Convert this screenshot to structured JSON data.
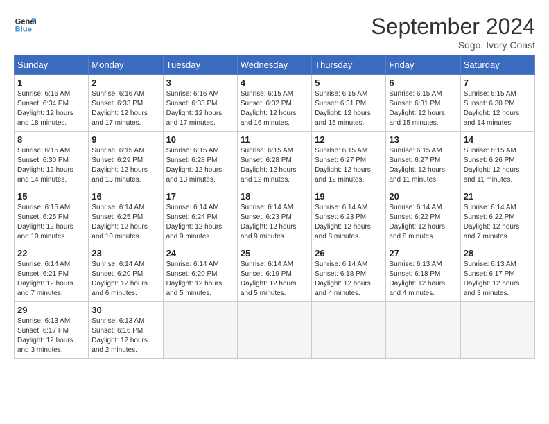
{
  "header": {
    "logo_line1": "General",
    "logo_line2": "Blue",
    "month_title": "September 2024",
    "subtitle": "Sogo, Ivory Coast"
  },
  "weekdays": [
    "Sunday",
    "Monday",
    "Tuesday",
    "Wednesday",
    "Thursday",
    "Friday",
    "Saturday"
  ],
  "weeks": [
    [
      {
        "day": "1",
        "sunrise": "6:16 AM",
        "sunset": "6:34 PM",
        "daylight": "12 hours and 18 minutes."
      },
      {
        "day": "2",
        "sunrise": "6:16 AM",
        "sunset": "6:33 PM",
        "daylight": "12 hours and 17 minutes."
      },
      {
        "day": "3",
        "sunrise": "6:16 AM",
        "sunset": "6:33 PM",
        "daylight": "12 hours and 17 minutes."
      },
      {
        "day": "4",
        "sunrise": "6:15 AM",
        "sunset": "6:32 PM",
        "daylight": "12 hours and 16 minutes."
      },
      {
        "day": "5",
        "sunrise": "6:15 AM",
        "sunset": "6:31 PM",
        "daylight": "12 hours and 15 minutes."
      },
      {
        "day": "6",
        "sunrise": "6:15 AM",
        "sunset": "6:31 PM",
        "daylight": "12 hours and 15 minutes."
      },
      {
        "day": "7",
        "sunrise": "6:15 AM",
        "sunset": "6:30 PM",
        "daylight": "12 hours and 14 minutes."
      }
    ],
    [
      {
        "day": "8",
        "sunrise": "6:15 AM",
        "sunset": "6:30 PM",
        "daylight": "12 hours and 14 minutes."
      },
      {
        "day": "9",
        "sunrise": "6:15 AM",
        "sunset": "6:29 PM",
        "daylight": "12 hours and 13 minutes."
      },
      {
        "day": "10",
        "sunrise": "6:15 AM",
        "sunset": "6:28 PM",
        "daylight": "12 hours and 13 minutes."
      },
      {
        "day": "11",
        "sunrise": "6:15 AM",
        "sunset": "6:28 PM",
        "daylight": "12 hours and 12 minutes."
      },
      {
        "day": "12",
        "sunrise": "6:15 AM",
        "sunset": "6:27 PM",
        "daylight": "12 hours and 12 minutes."
      },
      {
        "day": "13",
        "sunrise": "6:15 AM",
        "sunset": "6:27 PM",
        "daylight": "12 hours and 11 minutes."
      },
      {
        "day": "14",
        "sunrise": "6:15 AM",
        "sunset": "6:26 PM",
        "daylight": "12 hours and 11 minutes."
      }
    ],
    [
      {
        "day": "15",
        "sunrise": "6:15 AM",
        "sunset": "6:25 PM",
        "daylight": "12 hours and 10 minutes."
      },
      {
        "day": "16",
        "sunrise": "6:14 AM",
        "sunset": "6:25 PM",
        "daylight": "12 hours and 10 minutes."
      },
      {
        "day": "17",
        "sunrise": "6:14 AM",
        "sunset": "6:24 PM",
        "daylight": "12 hours and 9 minutes."
      },
      {
        "day": "18",
        "sunrise": "6:14 AM",
        "sunset": "6:23 PM",
        "daylight": "12 hours and 9 minutes."
      },
      {
        "day": "19",
        "sunrise": "6:14 AM",
        "sunset": "6:23 PM",
        "daylight": "12 hours and 8 minutes."
      },
      {
        "day": "20",
        "sunrise": "6:14 AM",
        "sunset": "6:22 PM",
        "daylight": "12 hours and 8 minutes."
      },
      {
        "day": "21",
        "sunrise": "6:14 AM",
        "sunset": "6:22 PM",
        "daylight": "12 hours and 7 minutes."
      }
    ],
    [
      {
        "day": "22",
        "sunrise": "6:14 AM",
        "sunset": "6:21 PM",
        "daylight": "12 hours and 7 minutes."
      },
      {
        "day": "23",
        "sunrise": "6:14 AM",
        "sunset": "6:20 PM",
        "daylight": "12 hours and 6 minutes."
      },
      {
        "day": "24",
        "sunrise": "6:14 AM",
        "sunset": "6:20 PM",
        "daylight": "12 hours and 5 minutes."
      },
      {
        "day": "25",
        "sunrise": "6:14 AM",
        "sunset": "6:19 PM",
        "daylight": "12 hours and 5 minutes."
      },
      {
        "day": "26",
        "sunrise": "6:14 AM",
        "sunset": "6:18 PM",
        "daylight": "12 hours and 4 minutes."
      },
      {
        "day": "27",
        "sunrise": "6:13 AM",
        "sunset": "6:18 PM",
        "daylight": "12 hours and 4 minutes."
      },
      {
        "day": "28",
        "sunrise": "6:13 AM",
        "sunset": "6:17 PM",
        "daylight": "12 hours and 3 minutes."
      }
    ],
    [
      {
        "day": "29",
        "sunrise": "6:13 AM",
        "sunset": "6:17 PM",
        "daylight": "12 hours and 3 minutes."
      },
      {
        "day": "30",
        "sunrise": "6:13 AM",
        "sunset": "6:16 PM",
        "daylight": "12 hours and 2 minutes."
      },
      null,
      null,
      null,
      null,
      null
    ]
  ]
}
